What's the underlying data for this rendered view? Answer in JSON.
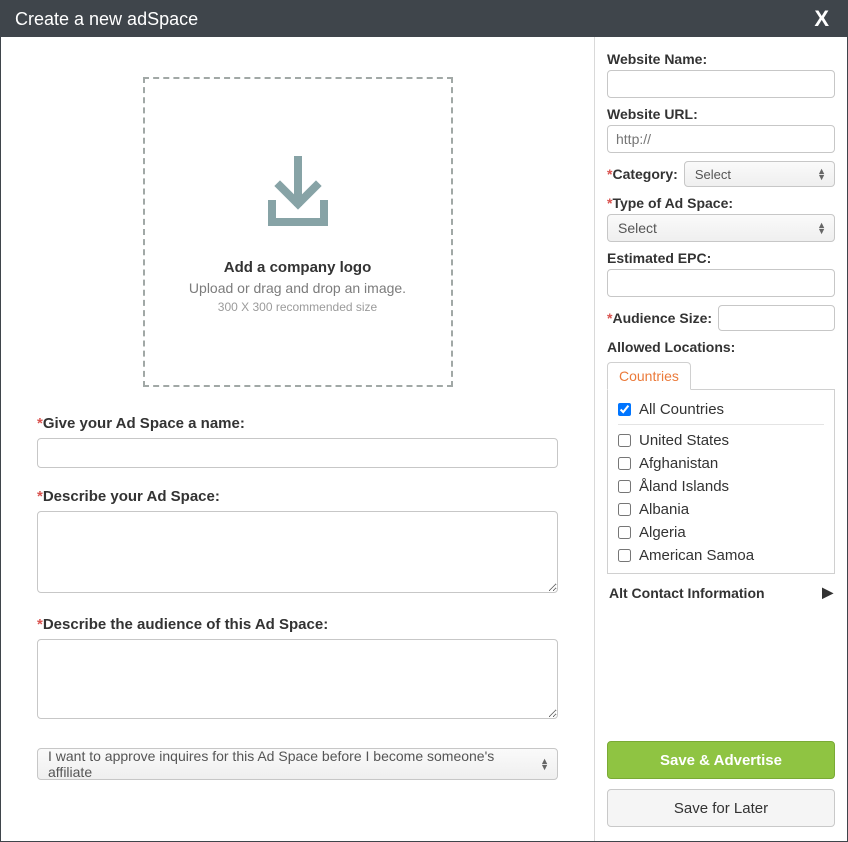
{
  "title": "Create a new adSpace",
  "close_label": "X",
  "upload": {
    "title": "Add a company logo",
    "subtitle": "Upload or drag and drop an image.",
    "hint": "300 X 300 recommended size"
  },
  "left": {
    "name_label": "Give your Ad Space a name:",
    "describe_label": "Describe your Ad Space:",
    "audience_label": "Describe the audience of this Ad Space:",
    "approve_select": "I want to approve inquires for this Ad Space before I become someone's affiliate"
  },
  "right": {
    "website_name_label": "Website Name:",
    "website_url_label": "Website URL:",
    "website_url_placeholder": "http://",
    "category_label": "Category:",
    "category_value": "Select",
    "type_label": "Type of Ad Space:",
    "type_value": "Select",
    "epc_label": "Estimated EPC:",
    "audience_size_label": "Audience Size:",
    "allowed_locations_label": "Allowed Locations:",
    "tab_countries": "Countries",
    "countries": [
      {
        "label": "All Countries",
        "checked": true
      },
      {
        "label": "United States",
        "checked": false
      },
      {
        "label": "Afghanistan",
        "checked": false
      },
      {
        "label": "Åland Islands",
        "checked": false
      },
      {
        "label": "Albania",
        "checked": false
      },
      {
        "label": "Algeria",
        "checked": false
      },
      {
        "label": "American Samoa",
        "checked": false
      }
    ],
    "alt_contact_label": "Alt Contact Information"
  },
  "buttons": {
    "primary": "Save & Advertise",
    "secondary": "Save for Later"
  }
}
